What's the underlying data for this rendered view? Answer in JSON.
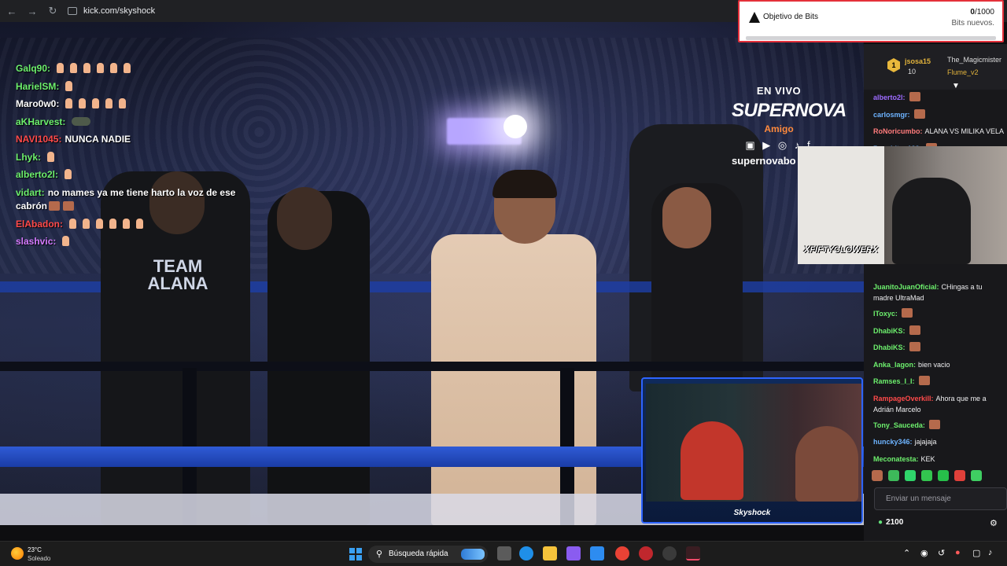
{
  "browser": {
    "url": "kick.com/skyshock",
    "back_icon": "arrow-left-icon",
    "forward_icon": "arrow-right-icon",
    "reload_icon": "reload-icon"
  },
  "stream": {
    "logo": {
      "live": "EN VIVO",
      "brand": "SUPERNOVA",
      "sponsor": "Amigo",
      "social": "▣ ▶ ◎ ♪ f",
      "handle": "supernovabo"
    },
    "team_shirt": "TEAM ALANA",
    "overlay_chat": [
      {
        "user": "Galq90:",
        "color": "#6df06d",
        "text": "",
        "hands": 6
      },
      {
        "user": "HarielSM:",
        "color": "#6df06d",
        "text": "",
        "hands": 1
      },
      {
        "user": "Maro0w0:",
        "color": "#ffffff",
        "text": "",
        "hands": 5
      },
      {
        "user": "aKHarvest:",
        "color": "#6df06d",
        "text": "",
        "hands": 0,
        "car": true
      },
      {
        "user": "NAVI1045:",
        "color": "#ff4a4a",
        "text": "NUNCA NADIE",
        "hands": 0
      },
      {
        "user": "Lhyk:",
        "color": "#6df06d",
        "text": "",
        "hands": 1
      },
      {
        "user": "alberto2l:",
        "color": "#6df06d",
        "text": "",
        "hands": 1
      },
      {
        "user": "vidart:",
        "color": "#6df06d",
        "text": "no mames ya me tiene harto la voz de ese cabrón",
        "hands": 0,
        "boxes": 2
      },
      {
        "user": "ElAbadon:",
        "color": "#ff4a4a",
        "text": "",
        "hands": 6
      },
      {
        "user": "slashvic:",
        "color": "#d57bff",
        "text": "",
        "hands": 1
      }
    ]
  },
  "bits_goal": {
    "title": "Objetivo de Bits",
    "count": "0",
    "goal": "/1000",
    "subtitle": "Bits nuevos.",
    "progress": 0
  },
  "chat": {
    "top": {
      "user1": "jsosa15",
      "user1_count": "10",
      "user2": "The_Magicmister",
      "user3": "Flume_v2"
    },
    "messages": [
      {
        "user": "alberto2l:",
        "color": "#9d6bff",
        "text": ""
      },
      {
        "user": "carlosmgr:",
        "color": "#6db3ff",
        "text": ""
      },
      {
        "user": "RoNoricumbo:",
        "color": "#ff7b7b",
        "text": "ALANA VS MILIKA VELA"
      },
      {
        "user": "Ponchitox133:",
        "color": "#6db3ff",
        "text": ""
      }
    ],
    "messages2": [
      {
        "user": "JuanitoJuanOficial:",
        "color": "#6df06d",
        "text": "CHingas a tu madre UltraMad",
        "wrap": true
      },
      {
        "user": "IToxyc:",
        "color": "#6df06d",
        "text": ""
      },
      {
        "user": "DhabiKS:",
        "color": "#6df06d",
        "text": ""
      },
      {
        "user": "DhabiKS:",
        "color": "#6df06d",
        "text": ""
      },
      {
        "user": "Anka_lagon:",
        "color": "#6df06d",
        "text": "bien vacio"
      },
      {
        "user": "Ramses_I_I:",
        "color": "#6df06d",
        "text": ""
      },
      {
        "user": "RampageOverkill:",
        "color": "#ff4a4a",
        "text": "Ahora que me a Adrián Marcelo",
        "wrap": true
      },
      {
        "user": "Tony_Sauceda:",
        "color": "#6df06d",
        "text": ""
      },
      {
        "user": "huncky346:",
        "color": "#6db3ff",
        "text": "jajajaja"
      },
      {
        "user": "Meconatesta:",
        "color": "#6df06d",
        "text": "KEK"
      }
    ],
    "input_placeholder": "Enviar un mensaje",
    "points": "2100",
    "settings_icon": "gear-icon"
  },
  "webcam": {
    "cam1_tag": "XFIFTYCLOWERX",
    "cam2_label": "Skyshock"
  },
  "taskbar": {
    "temp": "23°C",
    "weather": "Soleado",
    "search": "Búsqueda rápida",
    "tray_icons": [
      "chevron-up-icon",
      "network-icon",
      "sync-icon",
      "mic-icon",
      "display-icon",
      "volume-icon"
    ]
  },
  "colors": {
    "chat_bg": "#18181b",
    "accent_green": "#53fc18",
    "bits_border": "#e4303a"
  }
}
